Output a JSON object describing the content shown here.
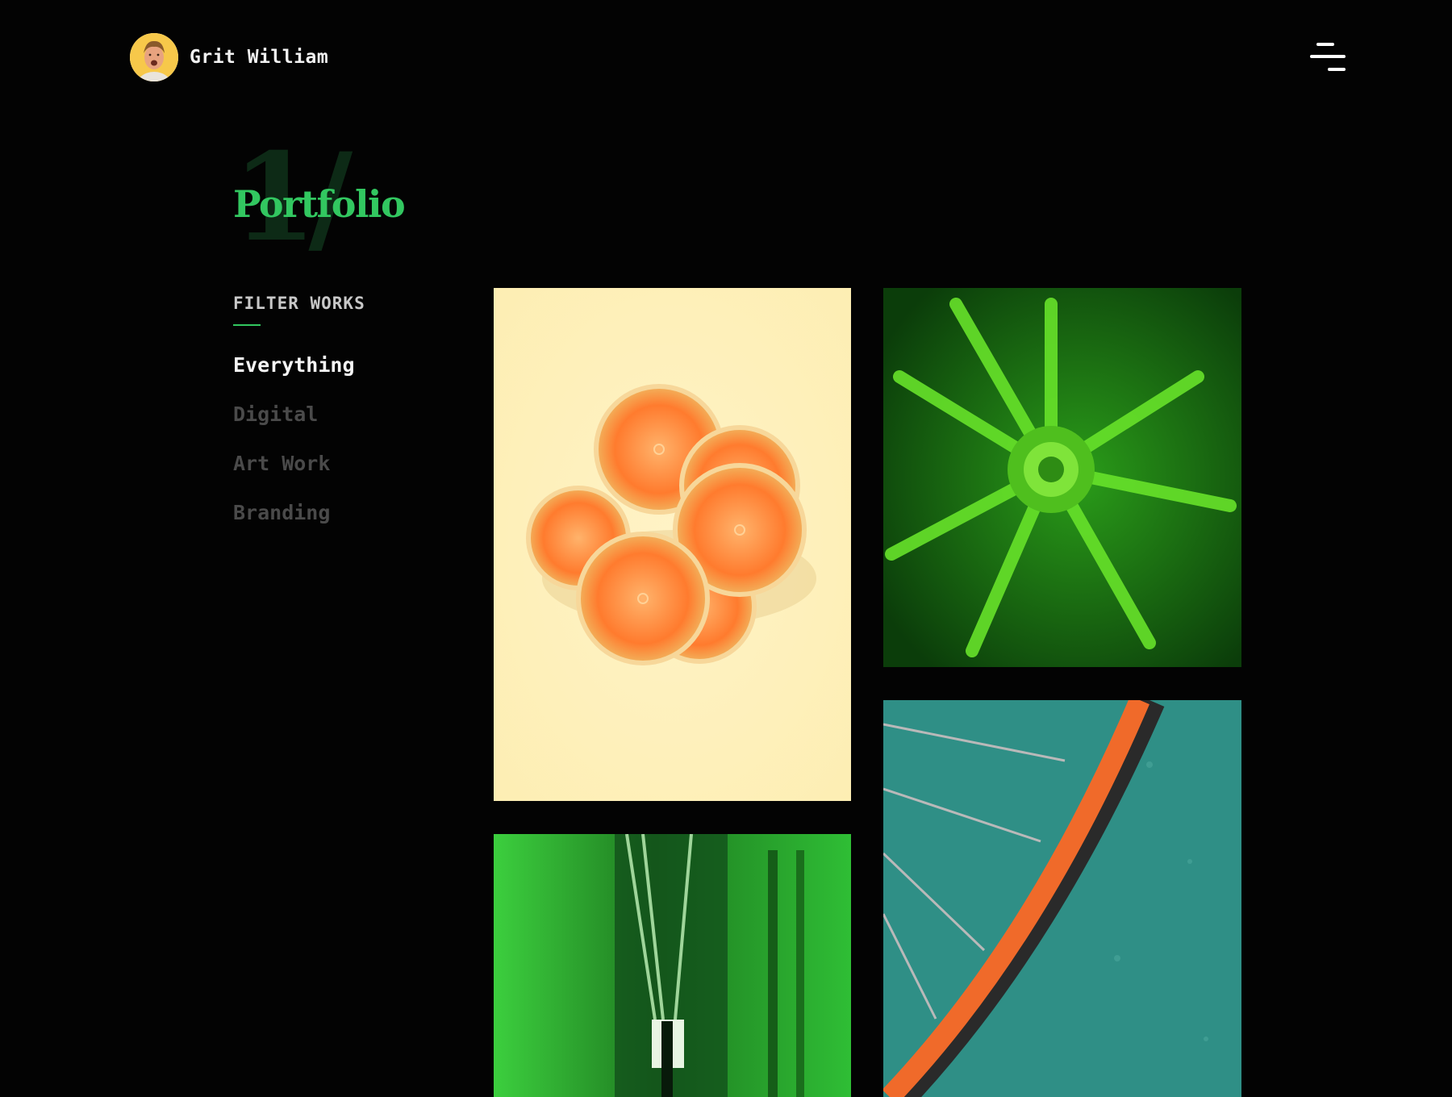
{
  "header": {
    "brand_name": "Grit William",
    "avatar_icon": "user-avatar",
    "menu_icon": "hamburger-menu-icon"
  },
  "section": {
    "number": "1/",
    "title": "Portfolio"
  },
  "filters": {
    "heading": "FILTER WORKS",
    "items": [
      {
        "label": "Everything",
        "active": true
      },
      {
        "label": "Digital",
        "active": false
      },
      {
        "label": "Art Work",
        "active": false
      },
      {
        "label": "Branding",
        "active": false
      }
    ]
  },
  "gallery": {
    "items": [
      {
        "subject": "dried-orange-slices",
        "background": "#fdf1bf"
      },
      {
        "subject": "green-fern-plant",
        "background": "#1c7a12"
      },
      {
        "subject": "green-corridor",
        "background": "#22a22e"
      },
      {
        "subject": "orange-bicycle-wheel",
        "background": "#2f8f86"
      }
    ]
  },
  "colors": {
    "background": "#030303",
    "accent": "#32c760",
    "text": "#f2f2f2",
    "muted": "#4a4a4a"
  }
}
